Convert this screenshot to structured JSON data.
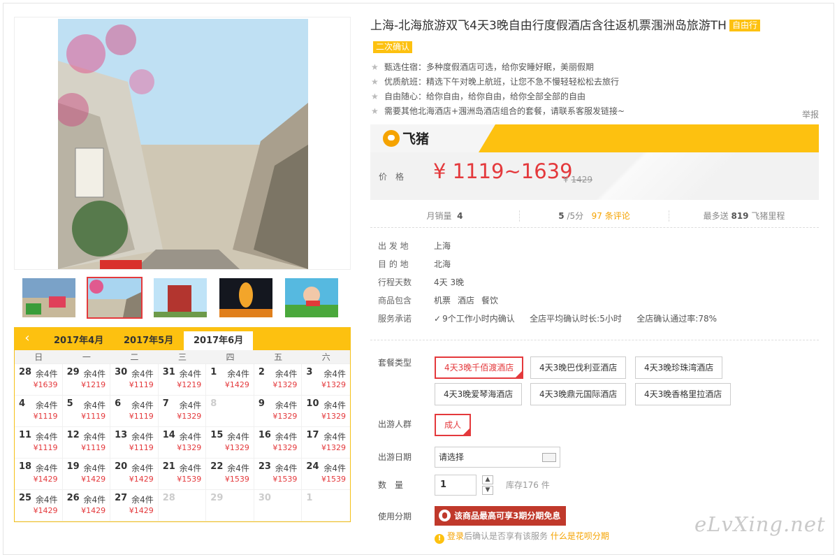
{
  "product": {
    "title": "上海-北海旅游双飞4天3晚自由行度假酒店含往返机票涠洲岛旅游TH",
    "tag_free": "自由行",
    "tag_confirm": "二次确认",
    "features": [
      "甄选住宿：多种度假酒店可选，给你安睡好眠，美丽假期",
      "优质航班：精选下午对晚上航班，让您不急不慢轻轻松松去旅行",
      "自由随心：给你自由，给你自由，给你全部全部的自由",
      "需要其他北海酒店+涠洲岛酒店组合的套餐，请联系客服发链接~"
    ],
    "report": "举报"
  },
  "brand": {
    "name": "飞猪"
  },
  "price": {
    "label": "价格",
    "range": "¥ 1119~1639",
    "currency": "¥",
    "original": "1429"
  },
  "stats": {
    "monthly_label": "月销量",
    "monthly_value": "4",
    "rating": "5",
    "rating_suffix": "/5分",
    "reviews": "97 条评论",
    "miles_prefix": "最多送",
    "miles_value": "819",
    "miles_suffix": "飞猪里程"
  },
  "info": [
    {
      "k": "出 发 地",
      "v": "上海"
    },
    {
      "k": "目 的 地",
      "v": "北海"
    },
    {
      "k": "行程天数",
      "v": "4天 3晚"
    },
    {
      "k": "商品包含",
      "v": ""
    },
    {
      "k": "服务承诺",
      "v": ""
    }
  ],
  "includes": [
    "机票",
    "酒店",
    "餐饮"
  ],
  "promises": [
    "9个工作小时内确认",
    "全店平均确认时长:5小时",
    "全店确认通过率:78%"
  ],
  "options": {
    "package_label": "套餐类型",
    "packages": [
      "4天3晚千佰渡酒店",
      "4天3晚巴伐利亚酒店",
      "4天3晚珍珠湾酒店",
      "4天3晚爱琴海酒店",
      "4天3晚鼎元国际酒店",
      "4天3晚香格里拉酒店"
    ],
    "crowd_label": "出游人群",
    "crowd": "成人",
    "date_label": "出游日期",
    "date_placeholder": "请选择",
    "qty_label": "数　量",
    "qty_value": "1",
    "stock": "库存176 件",
    "installment_label": "使用分期",
    "installment_btn": "该商品最高可享3期分期免息",
    "note_login": "登录",
    "note_mid": "后确认是否享有该服务",
    "note_link": "什么是花呗分期"
  },
  "calendar": {
    "prev": "‹",
    "tabs": [
      "2017年4月",
      "2017年5月",
      "2017年6月"
    ],
    "weekdays": [
      "日",
      "一",
      "二",
      "三",
      "四",
      "五",
      "六"
    ],
    "remain": "余4件",
    "days": [
      {
        "d": "28",
        "p": "¥1639"
      },
      {
        "d": "29",
        "p": "¥1219"
      },
      {
        "d": "30",
        "p": "¥1119"
      },
      {
        "d": "31",
        "p": "¥1219"
      },
      {
        "d": "1",
        "p": "¥1429"
      },
      {
        "d": "2",
        "p": "¥1329"
      },
      {
        "d": "3",
        "p": "¥1329"
      },
      {
        "d": "4",
        "p": "¥1119"
      },
      {
        "d": "5",
        "p": "¥1119"
      },
      {
        "d": "6",
        "p": "¥1119"
      },
      {
        "d": "7",
        "p": "¥1329"
      },
      {
        "d": "8",
        "p": ""
      },
      {
        "d": "9",
        "p": "¥1329"
      },
      {
        "d": "10",
        "p": "¥1329"
      },
      {
        "d": "11",
        "p": "¥1119"
      },
      {
        "d": "12",
        "p": "¥1119"
      },
      {
        "d": "13",
        "p": "¥1119"
      },
      {
        "d": "14",
        "p": "¥1329"
      },
      {
        "d": "15",
        "p": "¥1329"
      },
      {
        "d": "16",
        "p": "¥1329"
      },
      {
        "d": "17",
        "p": "¥1329"
      },
      {
        "d": "18",
        "p": "¥1429"
      },
      {
        "d": "19",
        "p": "¥1429"
      },
      {
        "d": "20",
        "p": "¥1429"
      },
      {
        "d": "21",
        "p": "¥1539"
      },
      {
        "d": "22",
        "p": "¥1539"
      },
      {
        "d": "23",
        "p": "¥1539"
      },
      {
        "d": "24",
        "p": "¥1539"
      },
      {
        "d": "25",
        "p": "¥1429"
      },
      {
        "d": "26",
        "p": "¥1429"
      },
      {
        "d": "27",
        "p": "¥1429"
      },
      {
        "d": "28",
        "p": ""
      },
      {
        "d": "29",
        "p": ""
      },
      {
        "d": "30",
        "p": ""
      },
      {
        "d": "1",
        "p": ""
      }
    ]
  },
  "watermark": "eLvXing.net",
  "colors": {
    "accent": "#fdc110",
    "price": "#e4393c",
    "installment": "#c0392b"
  }
}
